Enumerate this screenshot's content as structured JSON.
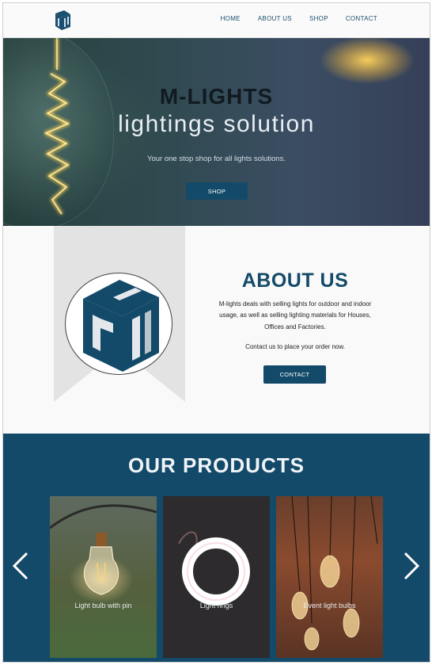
{
  "nav": {
    "links": [
      "HOME",
      "ABOUT US",
      "SHOP",
      "CONTACT"
    ]
  },
  "hero": {
    "title": "M-LIGHTS",
    "subtitle": "lightings solution",
    "tagline": "Your one stop shop for all lights solutions.",
    "button": "SHOP"
  },
  "about": {
    "title": "ABOUT US",
    "text": "M-lights deals with selling lights for outdoor and indoor usage, as well as selling lighting materials for Houses, Offices and Factories.",
    "text2": "Contact us to place your order now.",
    "button": "CONTACT"
  },
  "products": {
    "title": "OUR PRODUCTS",
    "items": [
      {
        "label": "Light bulb with pin"
      },
      {
        "label": "Light rings"
      },
      {
        "label": "Event light bulbs"
      }
    ]
  },
  "colors": {
    "brand": "#134a69",
    "nav_text": "#1f4f6e"
  },
  "icons": {
    "logo": "cube-logo-icon",
    "prev": "chevron-left-icon",
    "next": "chevron-right-icon"
  }
}
